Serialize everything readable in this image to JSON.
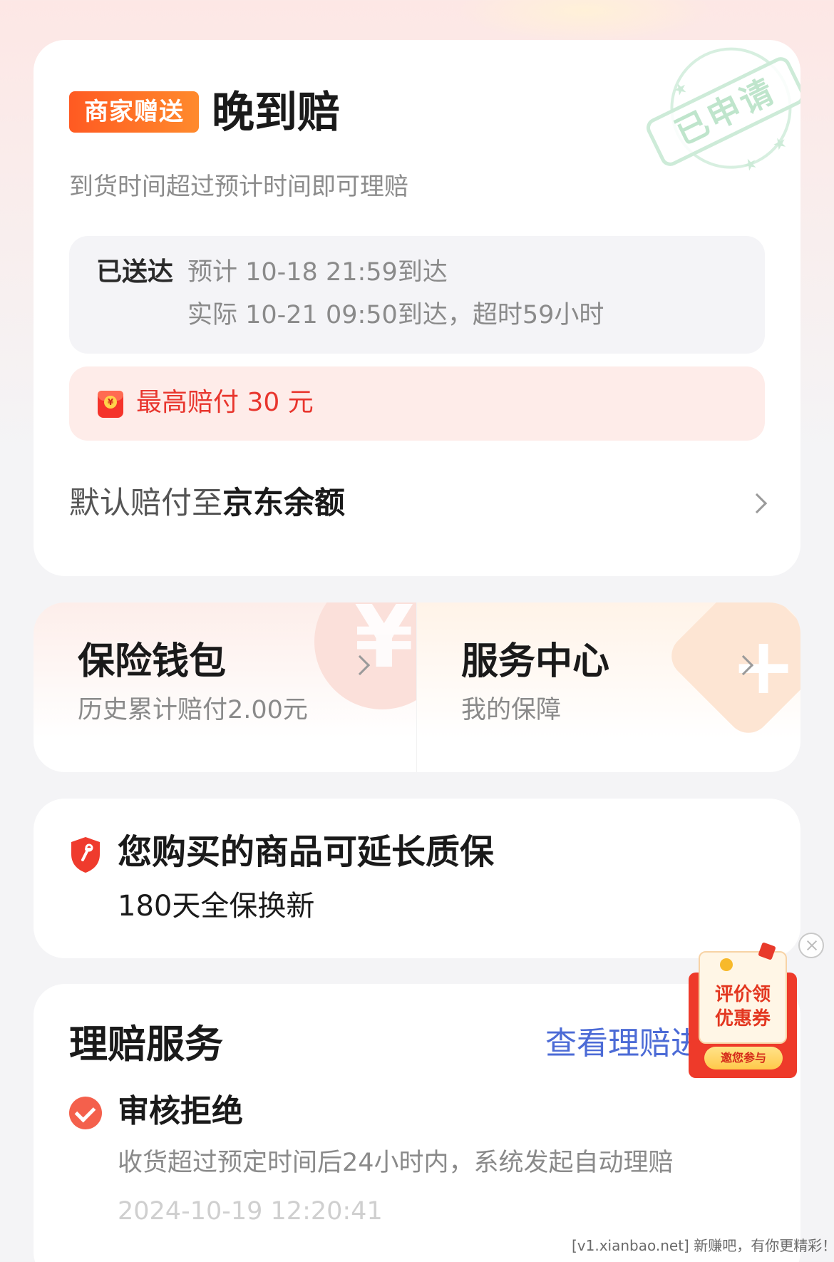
{
  "late_card": {
    "merchant_tag": "商家赠送",
    "title": "晚到赔",
    "subtitle": "到货时间超过预计时间即可理赔",
    "stamp_text": "已申请",
    "status_label": "已送达",
    "expected": "预计 10-18 21:59到达",
    "actual": "实际 10-21 09:50到达，超时59小时",
    "max_payout": "最高赔付 30 元",
    "default_pay_prefix": "默认赔付至",
    "default_pay_target": "京东余额"
  },
  "split_card": {
    "left": {
      "title": "保险钱包",
      "subtitle": "历史累计赔付2.00元"
    },
    "right": {
      "title": "服务中心",
      "subtitle": "我的保障"
    }
  },
  "warranty_card": {
    "title": "您购买的商品可延长质保",
    "subtitle": "180天全保换新"
  },
  "claim_card": {
    "title": "理赔服务",
    "link": "查看理赔进度",
    "status_title": "审核拒绝",
    "status_desc": "收货超过预定时间后24小时内，系统发起自动理赔",
    "status_time": "2024-10-19 12:20:41"
  },
  "floating_coupon": {
    "line1": "评价领",
    "line2": "优惠券",
    "button": "邀您参与"
  },
  "watermark": "[v1.xianbao.net] 新赚吧，有你更精彩！",
  "colors": {
    "accent_red": "#e8352d",
    "merchant_orange": "#ff6a26",
    "link_blue": "#4c6bd6",
    "stamp_green": "#cdebd8"
  }
}
